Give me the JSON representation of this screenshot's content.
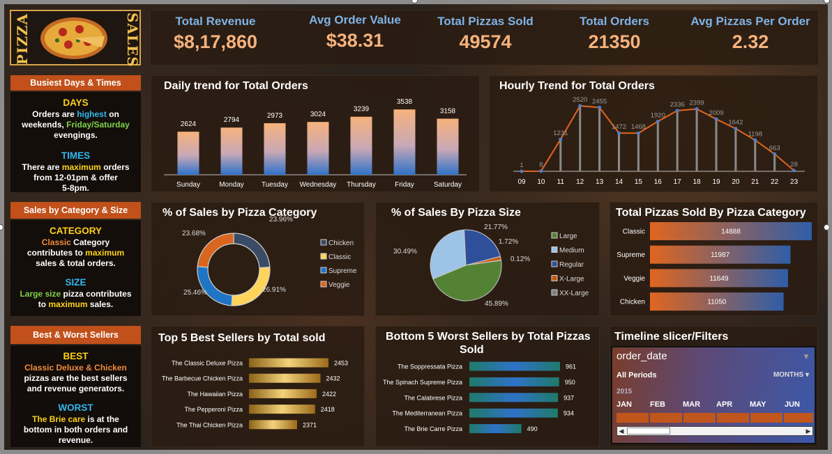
{
  "logo": {
    "word_left": "PIZZA",
    "word_right": "SALES"
  },
  "kpis": [
    {
      "label": "Total Revenue",
      "value": "$8,17,860"
    },
    {
      "label": "Avg Order Value",
      "value": "$38.31"
    },
    {
      "label": "Total Pizzas Sold",
      "value": "49574"
    },
    {
      "label": "Total Orders",
      "value": "21350"
    },
    {
      "label": "Avg Pizzas Per Order",
      "value": "2.32"
    }
  ],
  "notes": {
    "busiest": {
      "title": "Busiest Days & Times",
      "days_head": "DAYS",
      "days_1a": "Orders are ",
      "days_1b": "highest",
      "days_1c": " on",
      "days_2a": "weekends, ",
      "days_2b": "Friday/Saturday",
      "days_3": "evengings.",
      "times_head": "TIMES",
      "times_1a": "There are ",
      "times_1b": "maximum",
      "times_1c": " orders",
      "times_2": "from 12-01pm & offer",
      "times_3": "5-8pm."
    },
    "category": {
      "title": "Sales by Category & Size",
      "cat_head": "CATEGORY",
      "cat_1a": "Classic",
      "cat_1b": " Category",
      "cat_2a": "contributes to ",
      "cat_2b": "maximum",
      "cat_3": "sales & total orders.",
      "size_head": "SIZE",
      "size_1a": "Large size",
      "size_1b": " pizza contributes",
      "size_2a": "to ",
      "size_2b": "maximum",
      "size_2c": " sales."
    },
    "sellers": {
      "title": "Best & Worst Sellers",
      "best_head": "BEST",
      "best_1": "Classic Deluxe & Chicken",
      "best_2": "pizzas are the best sellers",
      "best_3": "and revenue generators.",
      "worst_head": "WORST",
      "worst_1a": "The Brie care",
      "worst_1b": " is at the",
      "worst_2": "bottom in both orders and",
      "worst_3": "revenue."
    }
  },
  "titles": {
    "daily": "Daily trend for Total Orders",
    "hourly": "Hourly Trend for Total Orders",
    "cat_pct": "% of Sales by Pizza Category",
    "size_pct": "% of Sales By Pizza Size",
    "cat_total": "Total Pizzas Sold By Pizza Category",
    "top5": "Top 5 Best Sellers by Total sold",
    "bottom5_1": "Bottom 5 Worst Sellers by Total Pizzas",
    "bottom5_2": "Sold",
    "slicer_panel": "Timeline slicer/Filters"
  },
  "slicer": {
    "field": "order_date",
    "periods": "All Periods",
    "unit": "MONTHS",
    "year": "2015",
    "months": [
      "JAN",
      "FEB",
      "MAR",
      "APR",
      "MAY",
      "JUN"
    ]
  },
  "colors": {
    "orange": "#e0661f",
    "blue": "#2f72c8",
    "peach": "#f6b27c",
    "gold": "#d7a531"
  },
  "chart_data": [
    {
      "id": "daily",
      "type": "bar",
      "title": "Daily trend for Total Orders",
      "categories": [
        "Sunday",
        "Monday",
        "Tuesday",
        "Wednesday",
        "Thursday",
        "Friday",
        "Saturday"
      ],
      "values": [
        2624,
        2794,
        2973,
        3024,
        3239,
        3538,
        3158
      ],
      "ylim": [
        0,
        4000
      ]
    },
    {
      "id": "hourly",
      "type": "line",
      "title": "Hourly Trend for Total Orders",
      "x": [
        "09",
        "10",
        "11",
        "12",
        "13",
        "14",
        "15",
        "16",
        "17",
        "18",
        "19",
        "20",
        "21",
        "22",
        "23"
      ],
      "values": [
        1,
        8,
        1231,
        2520,
        2455,
        1472,
        1468,
        1920,
        2336,
        2399,
        2009,
        1642,
        1198,
        663,
        28
      ],
      "ylim": [
        0,
        2600
      ]
    },
    {
      "id": "category_pct",
      "type": "pie",
      "title": "% of Sales by Pizza Category",
      "labels": [
        "Chicken",
        "Classic",
        "Supreme",
        "Veggie"
      ],
      "values": [
        23.96,
        26.91,
        25.46,
        23.68
      ],
      "value_labels": [
        "23.96%",
        "26.91%",
        "25.46%",
        "23.68%"
      ],
      "colors": [
        "#3b4b66",
        "#ffd45a",
        "#1f74c4",
        "#d9661f"
      ]
    },
    {
      "id": "size_pct",
      "type": "pie",
      "title": "% of Sales By Pizza Size",
      "labels": [
        "Large",
        "Medium",
        "Regular",
        "X-Large",
        "XX-Large"
      ],
      "values": [
        45.89,
        30.49,
        21.77,
        1.72,
        0.12
      ],
      "value_labels": [
        "45.89%",
        "30.49%",
        "21.77%",
        "1.72%",
        "0.12%"
      ],
      "legend": [
        "Large",
        "Medium",
        "Regular",
        "X-Large",
        "XX-Large"
      ],
      "colors": [
        "#548235",
        "#9dc3e6",
        "#2f4f9a",
        "#c55a11",
        "#7f7f7f"
      ]
    },
    {
      "id": "category_total",
      "type": "bar",
      "title": "Total Pizzas Sold By Pizza Category",
      "categories": [
        "Classic",
        "Supreme",
        "Veggie",
        "Chicken"
      ],
      "values": [
        14888,
        11987,
        11649,
        11050
      ]
    },
    {
      "id": "top5",
      "type": "bar",
      "title": "Top 5 Best Sellers by Total sold",
      "categories": [
        "The Classic Deluxe Pizza",
        "The Barbecue Chicken Pizza",
        "The Hawaiian Pizza",
        "The Pepperoni Pizza",
        "The Thai Chicken Pizza"
      ],
      "values": [
        2453,
        2432,
        2422,
        2418,
        2371
      ]
    },
    {
      "id": "bottom5",
      "type": "bar",
      "title": "Bottom 5 Worst Sellers by Total Pizzas Sold",
      "categories": [
        "The Soppressata Pizza",
        "The Spinach Supreme Pizza",
        "The Calabrese Pizza",
        "The Mediterranean Pizza",
        "The Brie Carre Pizza"
      ],
      "values": [
        961,
        950,
        937,
        934,
        490
      ]
    }
  ]
}
